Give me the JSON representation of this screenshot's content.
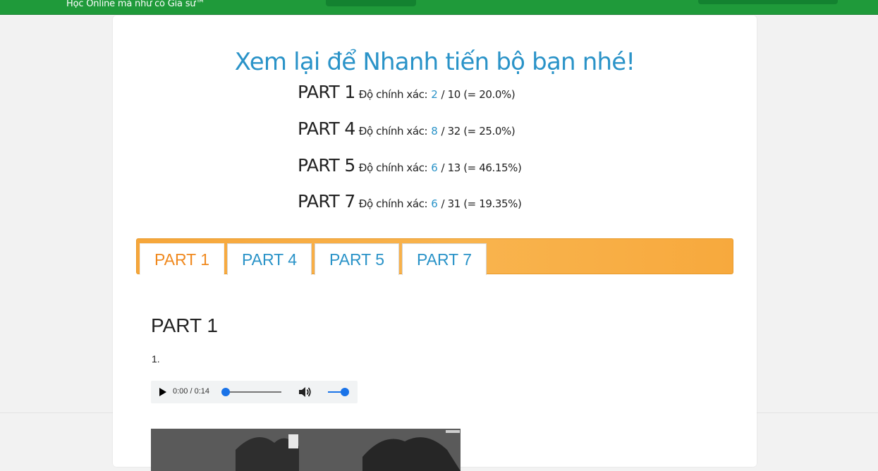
{
  "header": {
    "slogan": "Học Online mà như có Gia sư™"
  },
  "review": {
    "headline": "Xem lại để Nhanh tiến bộ bạn nhé!",
    "accuracy_label": "Độ chính xác:",
    "scores": [
      {
        "part": "PART 1",
        "correct": "2",
        "total": "/ 10 (= 20.0%)"
      },
      {
        "part": "PART 4",
        "correct": "8",
        "total": "/ 32 (= 25.0%)"
      },
      {
        "part": "PART 5",
        "correct": "6",
        "total": "/ 13 (= 46.15%)"
      },
      {
        "part": "PART 7",
        "correct": "6",
        "total": "/ 31 (= 19.35%)"
      }
    ]
  },
  "tabs": [
    {
      "label": "PART 1",
      "active": true
    },
    {
      "label": "PART 4",
      "active": false
    },
    {
      "label": "PART 5",
      "active": false
    },
    {
      "label": "PART 7",
      "active": false
    }
  ],
  "section": {
    "title": "PART 1",
    "question_number": "1.",
    "audio": {
      "time": "0:00 / 0:14",
      "progress": 0.0,
      "volume": 1.0
    }
  },
  "colors": {
    "brand_green": "#1f9a3a",
    "accent_blue": "#2a93c8",
    "tab_orange": "#f6a63a",
    "active_tab_text": "#f0891e"
  },
  "icons": [
    "play-icon",
    "volume-icon"
  ]
}
